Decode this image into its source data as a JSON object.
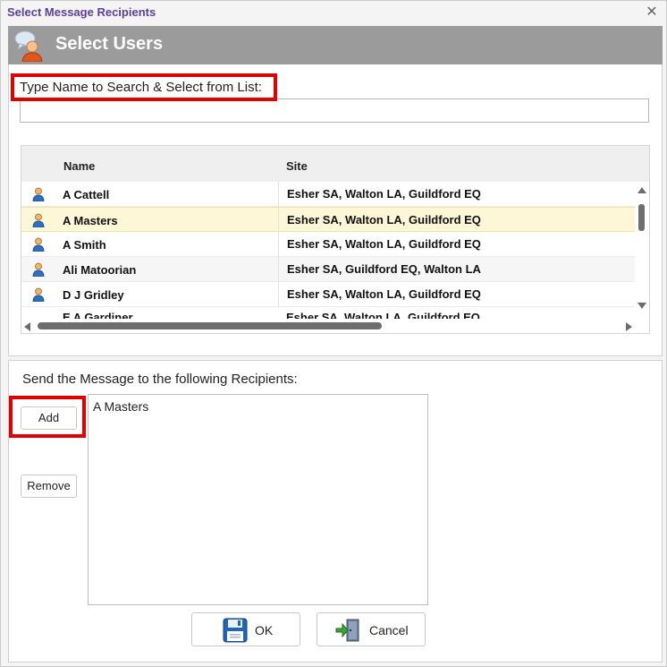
{
  "window": {
    "title": "Select Message Recipients",
    "close_glyph": "✕"
  },
  "header": {
    "title": "Select Users",
    "icon": "users-speech-icon"
  },
  "search": {
    "label": "Type Name to Search & Select from List:",
    "value": "",
    "placeholder": ""
  },
  "grid": {
    "columns": [
      "Name",
      "Site"
    ],
    "rows": [
      {
        "name": "A Cattell",
        "site": "Esher SA, Walton LA, Guildford EQ"
      },
      {
        "name": "A Masters",
        "site": "Esher SA, Walton LA, Guildford EQ"
      },
      {
        "name": "A Smith",
        "site": "Esher SA, Walton LA, Guildford EQ"
      },
      {
        "name": "Ali Matoorian",
        "site": "Esher SA, Guildford EQ, Walton LA"
      },
      {
        "name": "D J Gridley",
        "site": "Esher SA, Walton LA, Guildford EQ"
      }
    ],
    "partial_row": {
      "name": "E A Gardiner",
      "site": "Esher SA, Walton LA, Guildford EQ"
    },
    "selected_index": 1,
    "row_icon": "user-icon"
  },
  "recipients": {
    "label": "Send the Message to the following Recipients:",
    "items": [
      "A Masters"
    ],
    "add_label": "Add",
    "remove_label": "Remove"
  },
  "footer": {
    "ok_label": "OK",
    "cancel_label": "Cancel",
    "ok_icon": "save-disk-icon",
    "cancel_icon": "exit-door-icon"
  },
  "colors": {
    "title_text": "#5b3f9e",
    "header_bg": "#9b9b9b",
    "highlight": "#e00000",
    "selected_row": "#fdf7d8"
  }
}
